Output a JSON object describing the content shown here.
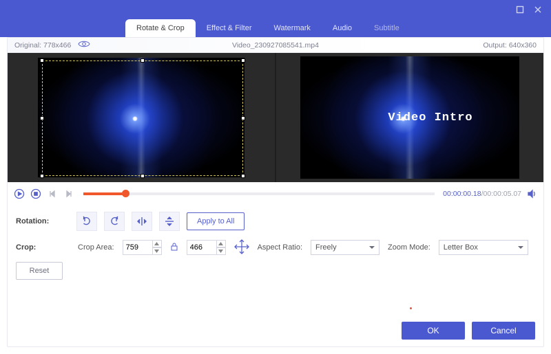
{
  "window": {
    "title": ""
  },
  "tabs": {
    "rotate_crop": "Rotate & Crop",
    "effect_filter": "Effect & Filter",
    "watermark": "Watermark",
    "audio": "Audio",
    "subtitle": "Subtitle"
  },
  "infobar": {
    "original_label": "Original:",
    "original_size": "778x466",
    "filename": "Video_230927085541.mp4",
    "output_label": "Output:",
    "output_size": "640x360"
  },
  "preview": {
    "overlay_text": "Video Intro"
  },
  "transport": {
    "position": "00:00:00.18",
    "duration": "00:00:05.07"
  },
  "rotation": {
    "label": "Rotation:",
    "apply_all": "Apply to All"
  },
  "crop": {
    "label": "Crop:",
    "crop_area_label": "Crop Area:",
    "width": "759",
    "height": "466",
    "aspect_ratio_label": "Aspect Ratio:",
    "aspect_ratio_value": "Freely",
    "zoom_mode_label": "Zoom Mode:",
    "zoom_mode_value": "Letter Box",
    "reset": "Reset"
  },
  "footer": {
    "ok": "OK",
    "cancel": "Cancel"
  }
}
